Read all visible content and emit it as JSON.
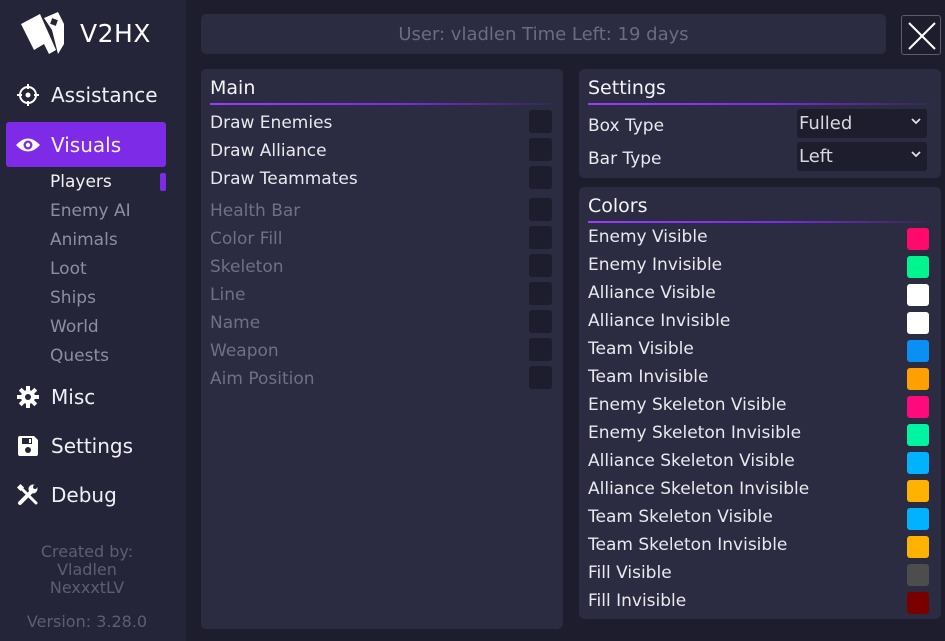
{
  "app": {
    "title": "V2HX",
    "logo_icon": "roblox-logo"
  },
  "sidebar": {
    "nav": [
      {
        "label": "Assistance",
        "icon": "crosshair-icon"
      },
      {
        "label": "Visuals",
        "icon": "eye-icon",
        "active": true
      },
      {
        "label": "Misc",
        "icon": "gear-icon"
      },
      {
        "label": "Settings",
        "icon": "floppy-icon"
      },
      {
        "label": "Debug",
        "icon": "tools-icon"
      }
    ],
    "sub": [
      "Players",
      "Enemy AI",
      "Animals",
      "Loot",
      "Ships",
      "World",
      "Quests"
    ],
    "credits_label": "Created by:",
    "credits_names": [
      "Vladlen",
      "NexxxtLV"
    ],
    "version": "Version: 3.28.0"
  },
  "header": {
    "user_text": "User: vladlen Time Left: 19 days"
  },
  "main_panel": {
    "title": "Main",
    "rows": [
      "Draw Enemies",
      "Draw Alliance",
      "Draw Teammates",
      "Health Bar",
      "Color Fill",
      "Skeleton",
      "Line",
      "Name",
      "Weapon",
      "Aim Position"
    ]
  },
  "settings_panel": {
    "title": "Settings",
    "box_type_label": "Box Type",
    "box_type_value": "Fulled",
    "bar_type_label": "Bar Type",
    "bar_type_value": "Left"
  },
  "colors_panel": {
    "title": "Colors",
    "items": [
      {
        "label": "Enemy Visible",
        "color": "#ff0a6c"
      },
      {
        "label": "Enemy Invisible",
        "color": "#00f58f"
      },
      {
        "label": "Alliance Visible",
        "color": "#ffffff"
      },
      {
        "label": "Alliance Invisible",
        "color": "#ffffff"
      },
      {
        "label": "Team Visible",
        "color": "#0a8ff5"
      },
      {
        "label": "Team Invisible",
        "color": "#ff9f00"
      },
      {
        "label": "Enemy Skeleton Visible",
        "color": "#ff0a7c"
      },
      {
        "label": "Enemy Skeleton Invisible",
        "color": "#00f5a0"
      },
      {
        "label": "Alliance Skeleton Visible",
        "color": "#00b2ff"
      },
      {
        "label": "Alliance Skeleton Invisible",
        "color": "#ffb300"
      },
      {
        "label": "Team Skeleton Visible",
        "color": "#00b2ff"
      },
      {
        "label": "Team Skeleton Invisible",
        "color": "#ffb300"
      },
      {
        "label": "Fill Visible",
        "color": "#4d4d4d"
      },
      {
        "label": "Fill Invisible",
        "color": "#7a0000"
      }
    ]
  }
}
